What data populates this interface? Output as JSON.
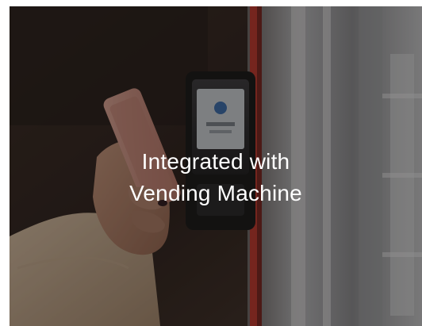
{
  "caption": {
    "line1": "Integrated with",
    "line2": "Vending Machine"
  },
  "colors": {
    "caption_text": "#ffffff",
    "overlay": "#140e0c",
    "frame_red": "#c23a2e"
  },
  "image": {
    "subject": "hand-holding-phone-at-vending-card-reader"
  }
}
